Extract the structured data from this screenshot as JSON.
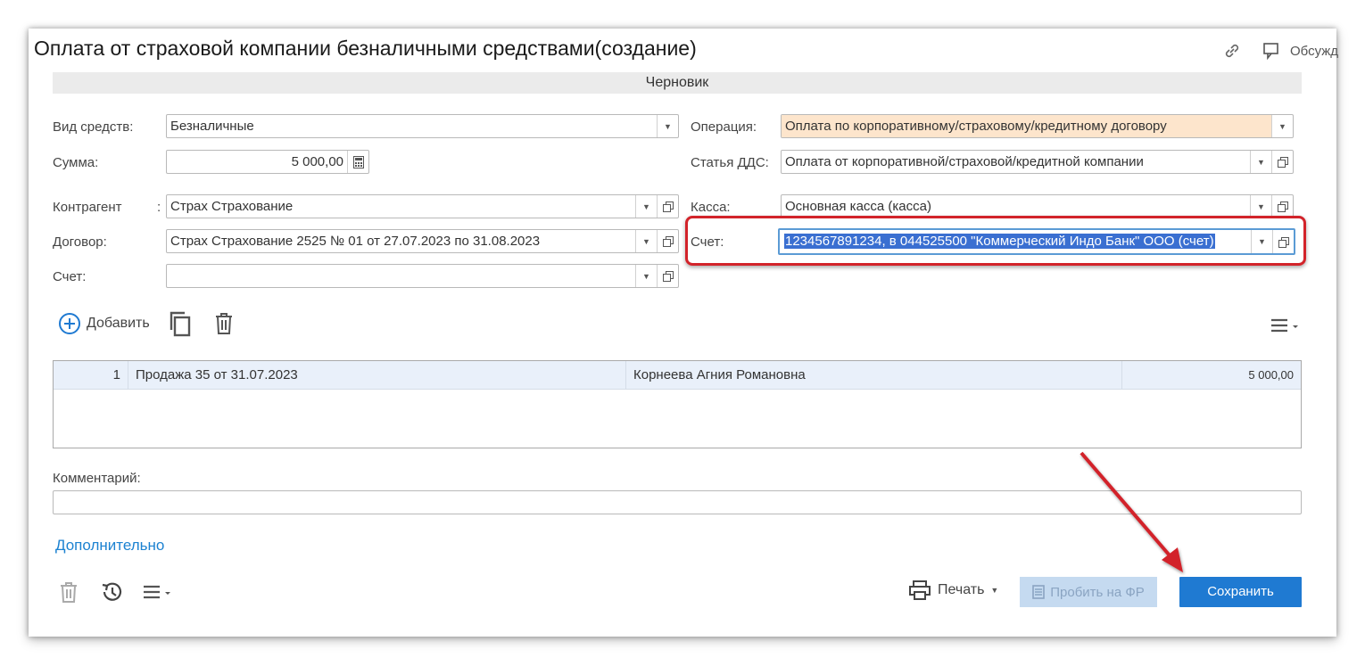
{
  "window": {
    "title": "Оплата от страховой компании безналичными средствами(создание)",
    "discuss_label": "Обсужд",
    "status": "Черновик"
  },
  "form": {
    "cash_type": {
      "label": "Вид средств:",
      "value": "Безналичные"
    },
    "amount": {
      "label": "Сумма:",
      "value": "5 000,00"
    },
    "counterparty": {
      "label": "Контрагент",
      "colon": ":",
      "value": "Страх Страхование"
    },
    "contract": {
      "label": "Договор:",
      "value": "Страх Страхование 2525  № 01 от 27.07.2023 по 31.08.2023"
    },
    "left_account": {
      "label": "Счет:",
      "value": ""
    },
    "operation": {
      "label": "Операция:",
      "value": "Оплата по корпоративному/страховому/кредитному договору"
    },
    "cash_flow_item": {
      "label": "Статья ДДС:",
      "value": "Оплата от корпоративной/страховой/кредитной компании"
    },
    "cashbox": {
      "label": "Касса:",
      "value": "Основная касса (касса)"
    },
    "account": {
      "label": "Счет:",
      "value": "1234567891234, в 044525500 \"Коммерческий Индо Банк\" ООО (счет)"
    }
  },
  "toolbar": {
    "add_label": "Добавить"
  },
  "table": {
    "rows": [
      {
        "num": "1",
        "doc": "Продажа 35 от 31.07.2023",
        "person": "Корнеева Агния Романовна",
        "amount": "5 000,00"
      }
    ]
  },
  "comment": {
    "label": "Комментарий:",
    "value": ""
  },
  "more_link": "Дополнительно",
  "footer": {
    "print_label": "Печать",
    "fiscal_label": "Пробить на ФР",
    "save_label": "Сохранить"
  },
  "colors": {
    "accent": "#1f7ad2",
    "annotation_red": "#d2232a",
    "operation_highlight": "#fde5cc",
    "link": "#1c82d1"
  }
}
